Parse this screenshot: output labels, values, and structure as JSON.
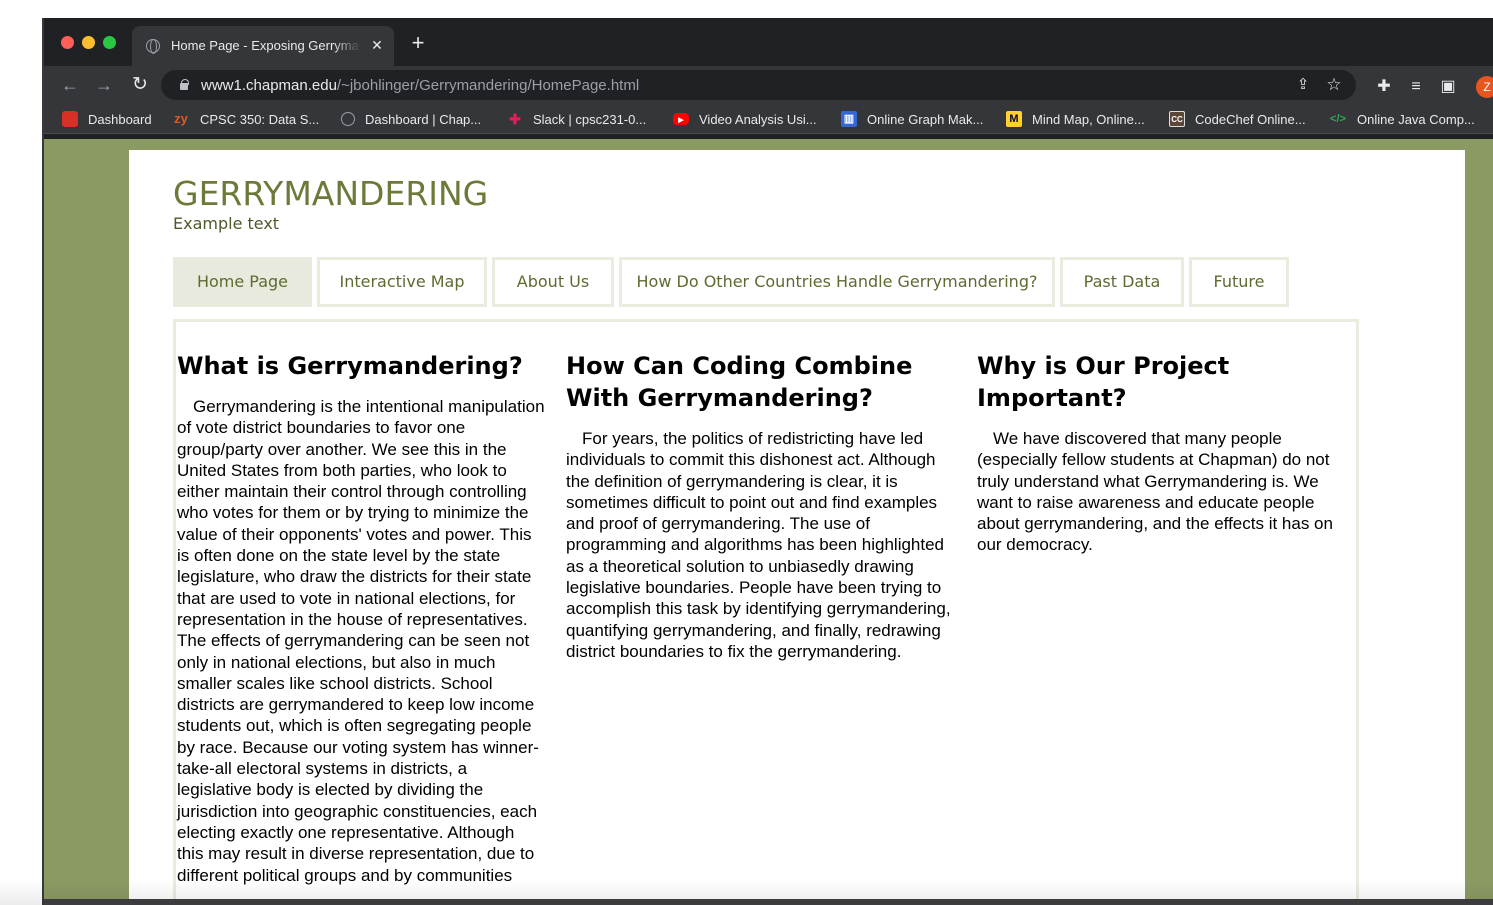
{
  "browser": {
    "tab_title": "Home Page - Exposing Gerrymandering",
    "tab_close": "✕",
    "new_tab": "+",
    "url_host": "www1.chapman.edu",
    "url_path": "/~jbohlinger/Gerrymandering/HomePage.html",
    "profile_initial": "Z",
    "bookmarks": [
      {
        "icon": "dashboard-icon",
        "icon_glyph": "",
        "icon_color": "#d93025",
        "label": "Dashboard"
      },
      {
        "icon": "zybooks-icon",
        "icon_glyph": "zy",
        "icon_color": "#e8561f",
        "label": "CPSC 350: Data S..."
      },
      {
        "icon": "globe-icon",
        "icon_glyph": "",
        "icon_color": "#9aa0a6",
        "label": "Dashboard | Chap..."
      },
      {
        "icon": "slack-icon",
        "icon_glyph": "✚",
        "icon_color": "#e01e5a",
        "label": "Slack | cpsc231-0..."
      },
      {
        "icon": "youtube-icon",
        "icon_glyph": "▶",
        "icon_color": "#ff0000",
        "label": "Video Analysis Usi..."
      },
      {
        "icon": "graph-icon",
        "icon_glyph": "▥",
        "icon_color": "#3367d6",
        "label": "Online Graph Mak..."
      },
      {
        "icon": "miro-icon",
        "icon_glyph": "M",
        "icon_color": "#ffd02f",
        "label": "Mind Map, Online..."
      },
      {
        "icon": "codechef-icon",
        "icon_glyph": "CC",
        "icon_color": "#5b4638",
        "label": "CodeChef Online..."
      },
      {
        "icon": "code-icon",
        "icon_glyph": "</>",
        "icon_color": "#34a853",
        "label": "Online Java Comp..."
      }
    ]
  },
  "site": {
    "title": "GERRYMANDERING",
    "subtitle": "Example text",
    "nav": [
      "Home Page",
      "Interactive Map",
      "About Us",
      "How Do Other Countries Handle Gerrymandering?",
      "Past Data",
      "Future"
    ],
    "active_nav": "Home Page",
    "colors": {
      "background": "#8b9a63",
      "title": "#6b7a39",
      "nav_active": "#e7eadc",
      "border": "#ebebe0"
    },
    "sections": [
      {
        "heading": "What is Gerrymandering?",
        "body": "Gerrymandering is the intentional manipulation of vote district boundaries to favor one group/party over another. We see this in the United States from both parties, who look to either maintain their control through controlling who votes for them or by trying to minimize the value of their opponents' votes and power. This is often done on the state level by the state legislature, who draw the districts for their state that are used to vote in national elections, for representation in the house of representatives. The effects of gerrymandering can be seen not only in national elections, but also in much smaller scales like school districts. School districts are gerrymandered to keep low income students out, which is often segregating people by race. Because our voting system has winner-take-all electoral systems in districts, a legislative body is elected by dividing the jurisdiction into geographic constituencies, each electing exactly one representative. Although this may result in diverse representation, due to different political groups and by communities"
      },
      {
        "heading": "How Can Coding Combine With Gerrymandering?",
        "body": "For years, the politics of redistricting have led individuals to commit this dishonest act. Although the definition of gerrymandering is clear, it is sometimes difficult to point out and find examples and proof of gerrymandering. The use of programming and algorithms has been highlighted as a theoretical solution to unbiasedly drawing legislative boundaries. People have been trying to accomplish this task by identifying gerrymandering, quantifying gerrymandering, and finally, redrawing district boundaries to fix the gerrymandering."
      },
      {
        "heading": "Why is Our Project Important?",
        "body": "We have discovered that many people (especially fellow students at Chapman) do not truly understand what Gerrymandering is. We want to raise awareness and educate people about gerrymandering, and the effects it has on our democracy."
      }
    ]
  }
}
